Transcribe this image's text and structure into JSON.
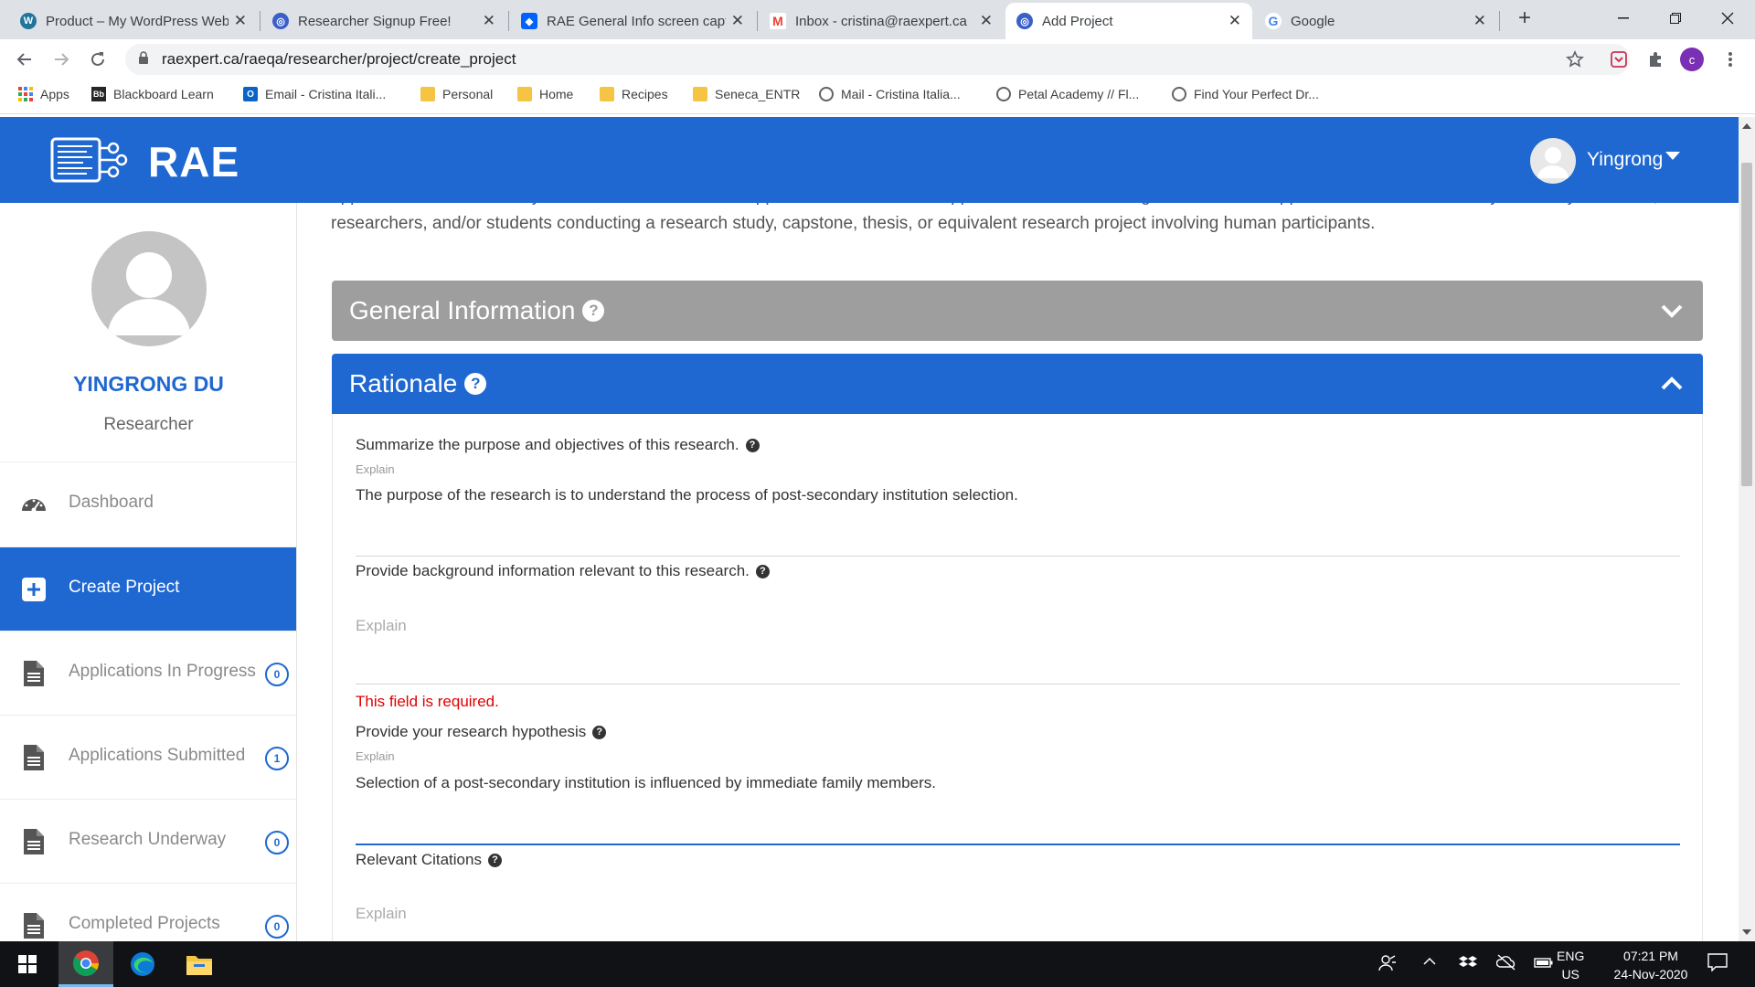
{
  "browser": {
    "tabs": [
      {
        "title": "Product – My WordPress Website",
        "icon": "wordpress-icon",
        "color": "#21759b"
      },
      {
        "title": "Researcher Signup Free!",
        "icon": "globe-icon",
        "color": "#3b5fc8"
      },
      {
        "title": "RAE General Info screen capture",
        "icon": "dropbox-icon",
        "color": "#0061fe"
      },
      {
        "title": "Inbox - cristina@raexpert.ca",
        "icon": "gmail-icon",
        "color": "#ea4335"
      },
      {
        "title": "Add Project",
        "icon": "globe-icon",
        "color": "#3b5fc8"
      },
      {
        "title": "Google",
        "icon": "google-icon",
        "color": "#4285f4"
      }
    ],
    "new_tab_label": "+",
    "url": "raexpert.ca/raeqa/researcher/project/create_project",
    "profile_initial": "c",
    "profile_color": "#7b2fb5",
    "bookmarks": [
      {
        "label": "Apps",
        "icon": "apps-grid-icon"
      },
      {
        "label": "Blackboard Learn",
        "icon": "blackboard-icon"
      },
      {
        "label": "Email - Cristina Itali...",
        "icon": "outlook-icon"
      },
      {
        "label": "Personal",
        "icon": "folder-icon"
      },
      {
        "label": "Home",
        "icon": "folder-icon"
      },
      {
        "label": "Recipes",
        "icon": "folder-icon"
      },
      {
        "label": "Seneca_ENTR",
        "icon": "folder-icon"
      },
      {
        "label": "Mail - Cristina Italia...",
        "icon": "globe-icon"
      },
      {
        "label": "Petal Academy // Fl...",
        "icon": "globe-icon"
      },
      {
        "label": "Find Your Perfect Dr...",
        "icon": "globe-icon"
      }
    ]
  },
  "app": {
    "brand": "RAE",
    "brand_color": "#1f68d1",
    "user_menu_name": "Yingrong"
  },
  "sidebar": {
    "profile_name": "YINGRONG DU",
    "profile_role": "Researcher",
    "items": [
      {
        "label": "Dashboard",
        "icon": "dashboard-icon",
        "badge": null,
        "active": false
      },
      {
        "label": "Create Project",
        "icon": "plus-square-icon",
        "badge": null,
        "active": true
      },
      {
        "label": "Applications In Progress",
        "icon": "document-icon",
        "badge": "0",
        "active": false
      },
      {
        "label": "Applications Submitted",
        "icon": "document-icon",
        "badge": "1",
        "active": false
      },
      {
        "label": "Research Underway",
        "icon": "document-icon",
        "badge": "0",
        "active": false
      },
      {
        "label": "Completed Projects",
        "icon": "document-icon",
        "badge": "0",
        "active": false
      }
    ]
  },
  "main": {
    "intro_text": "application is to be used by both internal and external applicants to obtain REB approval before conducting research. This application should be used by all faculty members, researchers, and/or students conducting a research study, capstone, thesis, or equivalent research project involving human participants.",
    "sections": [
      {
        "title": "General Information",
        "expanded": false,
        "color": "#9e9e9e"
      },
      {
        "title": "Rationale",
        "expanded": true,
        "color": "#1f68d1"
      }
    ],
    "questions": [
      {
        "label": "Summarize the purpose and objectives of this research.",
        "small_label": "Explain",
        "value": "The purpose of the research is to understand the process of post-secondary institution selection.",
        "placeholder": "",
        "error": ""
      },
      {
        "label": "Provide background information relevant to this research.",
        "small_label": "",
        "value": "",
        "placeholder": "Explain",
        "error": "This field is required."
      },
      {
        "label": "Provide your research hypothesis",
        "small_label": "Explain",
        "value": "Selection of a post-secondary institution is influenced by immediate family members.",
        "placeholder": "",
        "error": ""
      },
      {
        "label": "Relevant Citations",
        "small_label": "",
        "value": "",
        "placeholder": "Explain",
        "error": ""
      }
    ],
    "error_color": "#e00000"
  },
  "taskbar": {
    "language_line1": "ENG",
    "language_line2": "US",
    "time": "07:21 PM",
    "date": "24-Nov-2020"
  }
}
